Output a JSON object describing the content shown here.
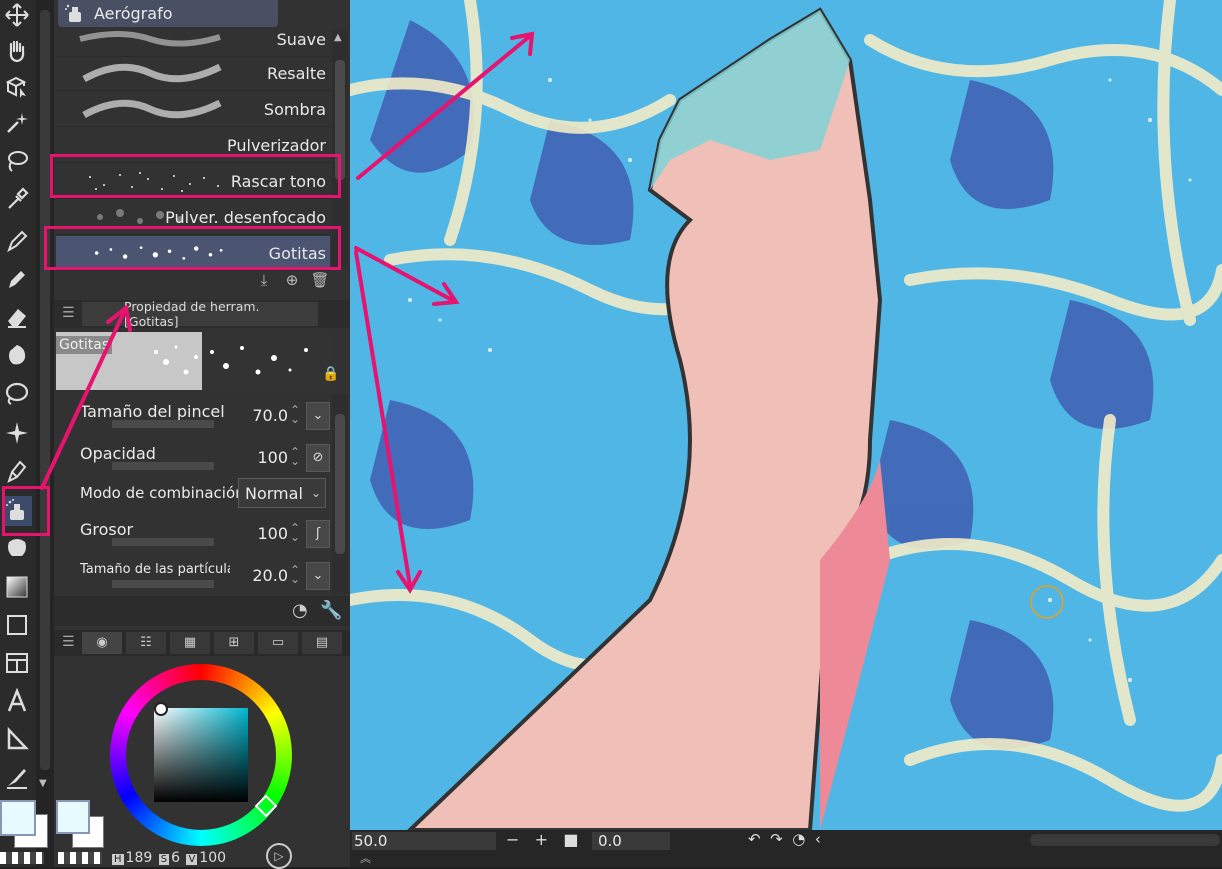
{
  "subtool": {
    "group_name": "Aerógrafo",
    "brushes": [
      {
        "label": "Suave"
      },
      {
        "label": "Resalte"
      },
      {
        "label": "Sombra"
      },
      {
        "label": "Pulverizador"
      },
      {
        "label": "Rascar tono"
      },
      {
        "label": "Pulver. desenfocado"
      },
      {
        "label": "Gotitas"
      }
    ],
    "selected": "Gotitas"
  },
  "tool_property": {
    "tab_title": "Propiedad de herram. [Gotitas]",
    "preview_name": "Gotitas",
    "rows": [
      {
        "label": "Tamaño del pincel",
        "value": "70.0"
      },
      {
        "label": "Opacidad",
        "value": "100"
      },
      {
        "label": "Grosor",
        "value": "100"
      },
      {
        "label": "Tamaño de las partículas",
        "value": "20.0"
      }
    ],
    "blend_mode_label": "Modo de combinación",
    "blend_mode_value": "Normal"
  },
  "color": {
    "main": "#e7fbff",
    "h_label": "H",
    "h_value": "189",
    "s_label": "S",
    "s_value": "6",
    "v_label": "V",
    "v_value": "100"
  },
  "statusbar": {
    "zoom": "50.0",
    "angle": "0.0"
  },
  "icons": [
    "move-icon",
    "hand-icon",
    "object-icon",
    "magic-wand-icon",
    "lasso-icon",
    "eyedropper-icon",
    "pen-icon",
    "pencil-icon",
    "eraser-icon",
    "blend-icon",
    "fill-icon",
    "sparkle-icon",
    "inking-pen-icon",
    "airbrush-icon",
    "gradient-icon",
    "rectangle-icon",
    "frame-icon",
    "text-icon",
    "ruler-icon",
    "correction-icon"
  ],
  "colors": {
    "accent": "#e8136e",
    "selection": "#4b5470",
    "water": "#4fb6e6",
    "skin": "#f0c0b8"
  }
}
